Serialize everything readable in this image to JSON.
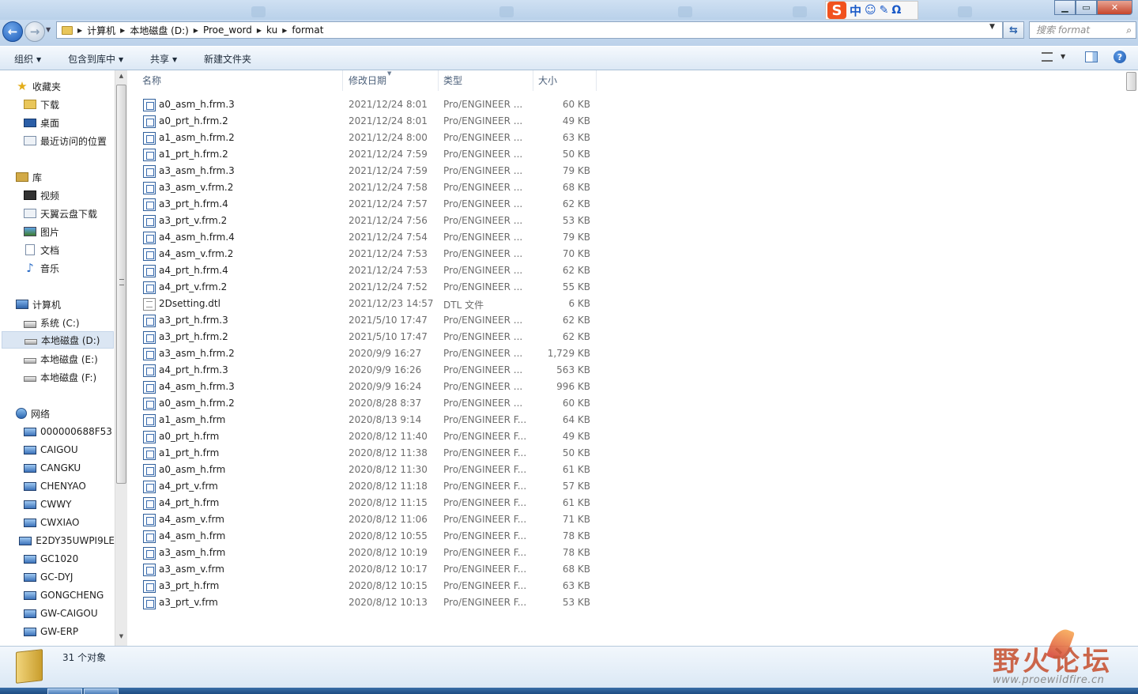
{
  "ime": {
    "logo": "S",
    "mode": "中",
    "icon_smile": "☺",
    "icon_pen": "✎",
    "icon_omega": "Ω"
  },
  "nav": {
    "back": "←",
    "forward": "→"
  },
  "address": {
    "crumbs": [
      "计算机",
      "本地磁盘 (D:)",
      "Proe_word",
      "ku",
      "format"
    ]
  },
  "search": {
    "placeholder": "搜索 format"
  },
  "toolbar": {
    "organize": "组织",
    "include_library": "包含到库中",
    "share": "共享",
    "new_folder": "新建文件夹"
  },
  "sidebar": {
    "favorites": {
      "label": "收藏夹",
      "items": [
        "下载",
        "桌面",
        "最近访问的位置"
      ]
    },
    "libraries": {
      "label": "库",
      "items": [
        "视频",
        "天翼云盘下载",
        "图片",
        "文档",
        "音乐"
      ]
    },
    "computer": {
      "label": "计算机",
      "items": [
        "系统 (C:)",
        "本地磁盘 (D:)",
        "本地磁盘 (E:)",
        "本地磁盘 (F:)"
      ],
      "selected": "本地磁盘 (D:)"
    },
    "network": {
      "label": "网络",
      "items": [
        "000000688F53",
        "CAIGOU",
        "CANGKU",
        "CHENYAO",
        "CWWY",
        "CWXIAO",
        "E2DY35UWPI9LE",
        "GC1020",
        "GC-DYJ",
        "GONGCHENG",
        "GW-CAIGOU",
        "GW-ERP"
      ]
    }
  },
  "columns": {
    "name": "名称",
    "date": "修改日期",
    "type": "类型",
    "size": "大小"
  },
  "files": [
    {
      "name": "a0_asm_h.frm.3",
      "date": "2021/12/24 8:01",
      "type": "Pro/ENGINEER ...",
      "size": "60 KB",
      "icon": "frm-icon"
    },
    {
      "name": "a0_prt_h.frm.2",
      "date": "2021/12/24 8:01",
      "type": "Pro/ENGINEER ...",
      "size": "49 KB",
      "icon": "frm-icon"
    },
    {
      "name": "a1_asm_h.frm.2",
      "date": "2021/12/24 8:00",
      "type": "Pro/ENGINEER ...",
      "size": "63 KB",
      "icon": "frm-icon"
    },
    {
      "name": "a1_prt_h.frm.2",
      "date": "2021/12/24 7:59",
      "type": "Pro/ENGINEER ...",
      "size": "50 KB",
      "icon": "frm-icon"
    },
    {
      "name": "a3_asm_h.frm.3",
      "date": "2021/12/24 7:59",
      "type": "Pro/ENGINEER ...",
      "size": "79 KB",
      "icon": "frm-icon"
    },
    {
      "name": "a3_asm_v.frm.2",
      "date": "2021/12/24 7:58",
      "type": "Pro/ENGINEER ...",
      "size": "68 KB",
      "icon": "frm-icon"
    },
    {
      "name": "a3_prt_h.frm.4",
      "date": "2021/12/24 7:57",
      "type": "Pro/ENGINEER ...",
      "size": "62 KB",
      "icon": "frm-icon"
    },
    {
      "name": "a3_prt_v.frm.2",
      "date": "2021/12/24 7:56",
      "type": "Pro/ENGINEER ...",
      "size": "53 KB",
      "icon": "frm-icon"
    },
    {
      "name": "a4_asm_h.frm.4",
      "date": "2021/12/24 7:54",
      "type": "Pro/ENGINEER ...",
      "size": "79 KB",
      "icon": "frm-icon"
    },
    {
      "name": "a4_asm_v.frm.2",
      "date": "2021/12/24 7:53",
      "type": "Pro/ENGINEER ...",
      "size": "70 KB",
      "icon": "frm-icon"
    },
    {
      "name": "a4_prt_h.frm.4",
      "date": "2021/12/24 7:53",
      "type": "Pro/ENGINEER ...",
      "size": "62 KB",
      "icon": "frm-icon"
    },
    {
      "name": "a4_prt_v.frm.2",
      "date": "2021/12/24 7:52",
      "type": "Pro/ENGINEER ...",
      "size": "55 KB",
      "icon": "frm-icon"
    },
    {
      "name": "2Dsetting.dtl",
      "date": "2021/12/23 14:57",
      "type": "DTL 文件",
      "size": "6 KB",
      "icon": "dtl-icon"
    },
    {
      "name": "a3_prt_h.frm.3",
      "date": "2021/5/10 17:47",
      "type": "Pro/ENGINEER ...",
      "size": "62 KB",
      "icon": "frm-icon"
    },
    {
      "name": "a3_prt_h.frm.2",
      "date": "2021/5/10 17:47",
      "type": "Pro/ENGINEER ...",
      "size": "62 KB",
      "icon": "frm-icon"
    },
    {
      "name": "a3_asm_h.frm.2",
      "date": "2020/9/9 16:27",
      "type": "Pro/ENGINEER ...",
      "size": "1,729 KB",
      "icon": "frm-icon"
    },
    {
      "name": "a4_prt_h.frm.3",
      "date": "2020/9/9 16:26",
      "type": "Pro/ENGINEER ...",
      "size": "563 KB",
      "icon": "frm-icon"
    },
    {
      "name": "a4_asm_h.frm.3",
      "date": "2020/9/9 16:24",
      "type": "Pro/ENGINEER ...",
      "size": "996 KB",
      "icon": "frm-icon"
    },
    {
      "name": "a0_asm_h.frm.2",
      "date": "2020/8/28 8:37",
      "type": "Pro/ENGINEER ...",
      "size": "60 KB",
      "icon": "frm-icon"
    },
    {
      "name": "a1_asm_h.frm",
      "date": "2020/8/13 9:14",
      "type": "Pro/ENGINEER F...",
      "size": "64 KB",
      "icon": "frm-icon"
    },
    {
      "name": "a0_prt_h.frm",
      "date": "2020/8/12 11:40",
      "type": "Pro/ENGINEER F...",
      "size": "49 KB",
      "icon": "frm-icon"
    },
    {
      "name": "a1_prt_h.frm",
      "date": "2020/8/12 11:38",
      "type": "Pro/ENGINEER F...",
      "size": "50 KB",
      "icon": "frm-icon"
    },
    {
      "name": "a0_asm_h.frm",
      "date": "2020/8/12 11:30",
      "type": "Pro/ENGINEER F...",
      "size": "61 KB",
      "icon": "frm-icon"
    },
    {
      "name": "a4_prt_v.frm",
      "date": "2020/8/12 11:18",
      "type": "Pro/ENGINEER F...",
      "size": "57 KB",
      "icon": "frm-icon"
    },
    {
      "name": "a4_prt_h.frm",
      "date": "2020/8/12 11:15",
      "type": "Pro/ENGINEER F...",
      "size": "61 KB",
      "icon": "frm-icon"
    },
    {
      "name": "a4_asm_v.frm",
      "date": "2020/8/12 11:06",
      "type": "Pro/ENGINEER F...",
      "size": "71 KB",
      "icon": "frm-icon"
    },
    {
      "name": "a4_asm_h.frm",
      "date": "2020/8/12 10:55",
      "type": "Pro/ENGINEER F...",
      "size": "78 KB",
      "icon": "frm-icon"
    },
    {
      "name": "a3_asm_h.frm",
      "date": "2020/8/12 10:19",
      "type": "Pro/ENGINEER F...",
      "size": "78 KB",
      "icon": "frm-icon"
    },
    {
      "name": "a3_asm_v.frm",
      "date": "2020/8/12 10:17",
      "type": "Pro/ENGINEER F...",
      "size": "68 KB",
      "icon": "frm-icon"
    },
    {
      "name": "a3_prt_h.frm",
      "date": "2020/8/12 10:15",
      "type": "Pro/ENGINEER F...",
      "size": "63 KB",
      "icon": "frm-icon"
    },
    {
      "name": "a3_prt_v.frm",
      "date": "2020/8/12 10:13",
      "type": "Pro/ENGINEER F...",
      "size": "53 KB",
      "icon": "frm-icon"
    }
  ],
  "status": {
    "count": "31 个对象"
  },
  "watermark": {
    "cn": "野火论坛",
    "url": "www.proewildfire.cn"
  }
}
